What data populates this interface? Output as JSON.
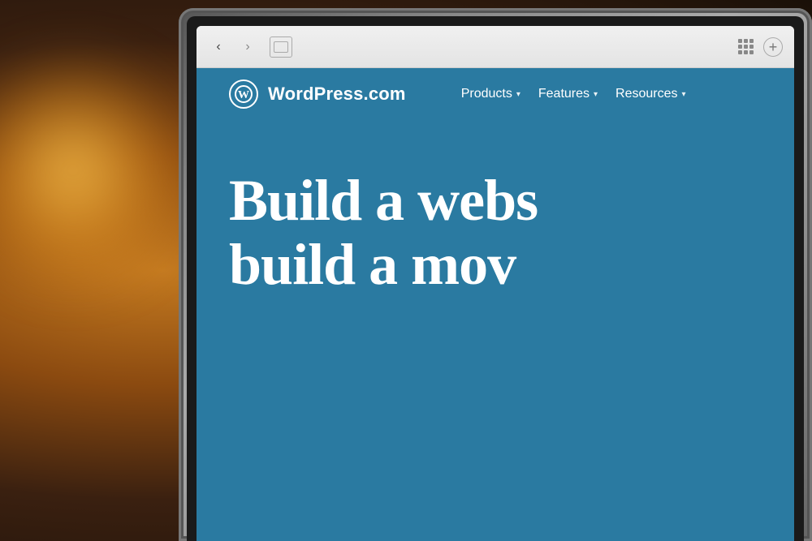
{
  "scene": {
    "background_description": "Warm blurred bokeh background with orange/amber light source on left"
  },
  "browser": {
    "back_button": "‹",
    "forward_button": "›",
    "toolbar_separator": "|"
  },
  "wordpress": {
    "logo_symbol": "W",
    "site_name": "WordPress.com",
    "nav_items": [
      {
        "label": "Products",
        "has_dropdown": true
      },
      {
        "label": "Features",
        "has_dropdown": true
      },
      {
        "label": "Resources",
        "has_dropdown": true
      }
    ],
    "hero_line1": "Build a webs",
    "hero_line2": "build a mov",
    "background_color": "#2a7aa1"
  }
}
